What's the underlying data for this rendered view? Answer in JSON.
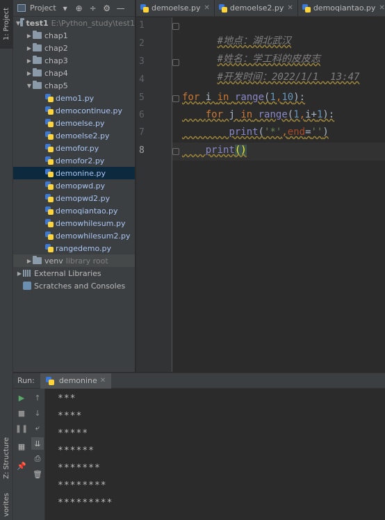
{
  "tool_strip": {
    "project_tab": "1: Project",
    "structure_tab": "Z: Structure",
    "favorites_tab": "vorites"
  },
  "project_panel": {
    "title": "Project",
    "tree": [
      {
        "label": "test1",
        "path": "E:\\Python_study\\test1",
        "type": "root",
        "expanded": true
      },
      {
        "label": "chap1",
        "type": "folder",
        "expanded": false
      },
      {
        "label": "chap2",
        "type": "folder",
        "expanded": false
      },
      {
        "label": "chap3",
        "type": "folder",
        "expanded": false
      },
      {
        "label": "chap4",
        "type": "folder",
        "expanded": false
      },
      {
        "label": "chap5",
        "type": "folder",
        "expanded": true
      },
      {
        "label": "demo1.py",
        "type": "file"
      },
      {
        "label": "democontinue.py",
        "type": "file"
      },
      {
        "label": "demoelse.py",
        "type": "file"
      },
      {
        "label": "demoelse2.py",
        "type": "file"
      },
      {
        "label": "demofor.py",
        "type": "file"
      },
      {
        "label": "demofor2.py",
        "type": "file"
      },
      {
        "label": "demonine.py",
        "type": "file",
        "selected": true
      },
      {
        "label": "demopwd.py",
        "type": "file"
      },
      {
        "label": "demopwd2.py",
        "type": "file"
      },
      {
        "label": "demoqiantao.py",
        "type": "file"
      },
      {
        "label": "demowhilesum.py",
        "type": "file"
      },
      {
        "label": "demowhilesum2.py",
        "type": "file"
      },
      {
        "label": "rangedemo.py",
        "type": "file"
      },
      {
        "label": "venv",
        "extra": "library root",
        "type": "folder",
        "expanded": false
      },
      {
        "label": "External Libraries",
        "type": "lib",
        "expanded": false
      },
      {
        "label": "Scratches and Consoles",
        "type": "scratch"
      }
    ]
  },
  "editor_tabs": [
    {
      "label": "demoelse.py"
    },
    {
      "label": "demoelse2.py"
    },
    {
      "label": "demoqiantao.py"
    }
  ],
  "editor": {
    "line_numbers": [
      "1",
      "2",
      "3",
      "4",
      "5",
      "6",
      "7",
      "8"
    ],
    "current_line": "8",
    "code": {
      "l1": "#地点：湖北武汉",
      "l2": "#姓名：学工科的皮皮志",
      "l3": "#开发时间：2022/1/1  13:47",
      "l5_for": "for",
      "l5_i": " i ",
      "l5_in": "in",
      "l5_range": "range",
      "l5_open": "(",
      "l5_n1": "1",
      "l5_comma": ",",
      "l5_n10": "10",
      "l5_close": "):",
      "l6_for": "for",
      "l6_j": " j ",
      "l6_in": "in",
      "l6_range": "range",
      "l6_open": "(",
      "l6_n1": "1",
      "l6_comma": ",",
      "l6_i": "i+",
      "l6_n1b": "1",
      "l6_close": "):",
      "l7_print": "print",
      "l7_open": "(",
      "l7_str": "'*'",
      "l7_comma": ",",
      "l7_end": "end",
      "l7_eq": "=",
      "l7_str2": "''",
      "l7_close": ")",
      "l8_print": "print",
      "l8_parens": "()"
    }
  },
  "run_panel": {
    "label": "Run:",
    "tab": "demonine",
    "output": [
      "***",
      "****",
      "*****",
      "******",
      "*******",
      "********",
      "*********"
    ]
  }
}
